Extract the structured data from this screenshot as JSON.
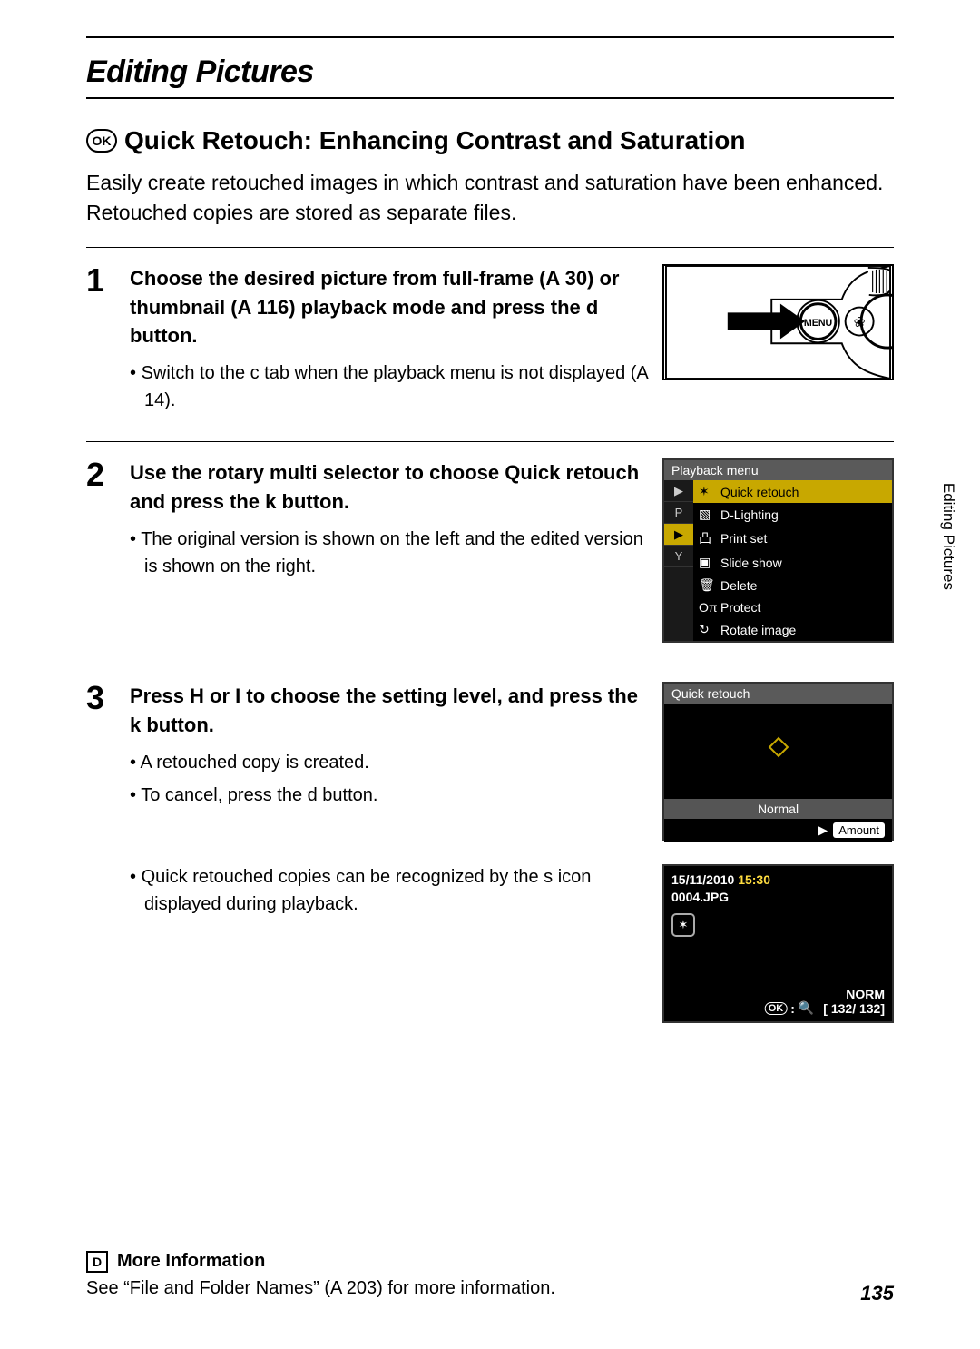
{
  "section_title": "Editing Pictures",
  "feature": {
    "icon_label": "OK",
    "title": "Quick Retouch: Enhancing Contrast and Saturation"
  },
  "intro": "Easily create retouched images in which contrast and saturation have been enhanced. Retouched copies are stored as separate files.",
  "steps": [
    {
      "num": "1",
      "text": "Choose the desired picture from full-frame (A 30) or thumbnail (A 116) playback mode and press the d button.",
      "bullets": [
        "Switch to the c tab when the playback menu is not displayed (A 14)."
      ]
    },
    {
      "num": "2",
      "text": "Use the rotary multi selector to choose  Quick retouch  and press the k button.",
      "bullets": [
        "The original version is shown on the left and the edited version is shown on the right."
      ]
    },
    {
      "num": "3",
      "text": "Press H  or I  to choose the setting level, and press the k button.",
      "bullets": [
        "A retouched copy is created.",
        "To cancel, press the d button.",
        "Quick retouched copies can be recognized by the s icon displayed during playback."
      ]
    }
  ],
  "menu": {
    "header": "Playback menu",
    "tabs": [
      "▶",
      "P",
      "▶",
      "Y"
    ],
    "items": [
      "Quick retouch",
      "D-Lighting",
      "Print set",
      "Slide show",
      "Delete",
      "Protect",
      "Rotate image"
    ]
  },
  "retouch": {
    "header": "Quick retouch",
    "slider_label": "Normal",
    "amount_label": "Amount"
  },
  "playback": {
    "date": "15/11/2010",
    "time": "15:30",
    "filename": "0004.JPG",
    "quality": "NORM",
    "counter": "[ 132/ 132]",
    "ok_label": "OK",
    "ok_action": ":"
  },
  "more_info": {
    "icon": "D",
    "title": "More Information",
    "body": "See “File and Folder Names” (A 203) for more information."
  },
  "side_tab": "Editing Pictures",
  "page_number": "135"
}
